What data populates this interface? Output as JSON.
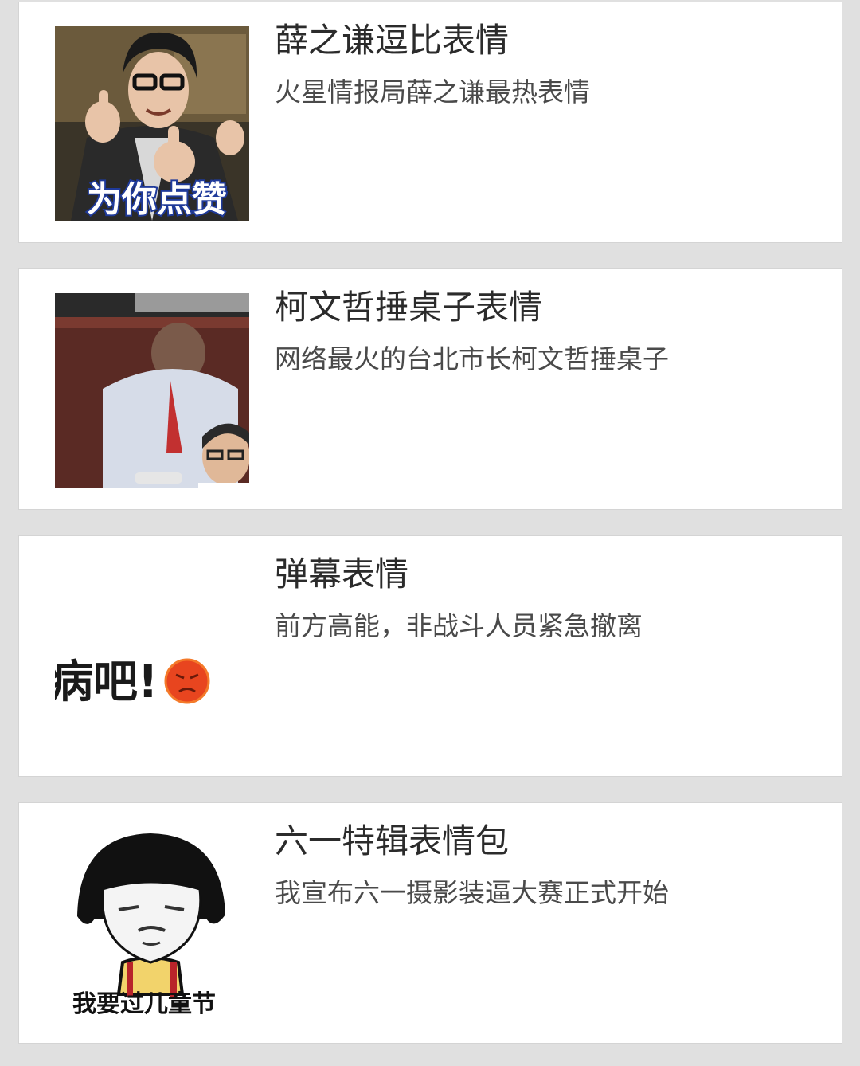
{
  "items": [
    {
      "title": "薛之谦逗比表情",
      "subtitle": "火星情报局薛之谦最热表情",
      "thumb_caption": "为你点赞"
    },
    {
      "title": "柯文哲捶桌子表情",
      "subtitle": "网络最火的台北市长柯文哲捶桌子"
    },
    {
      "title": "弹幕表情",
      "subtitle": "前方高能，非战斗人员紧急撤离",
      "thumb_caption": "病吧!"
    },
    {
      "title": "六一特辑表情包",
      "subtitle": "我宣布六一摄影装逼大赛正式开始",
      "thumb_caption": "我要过儿童节"
    }
  ],
  "colors": {
    "background": "#e0e0e0",
    "card": "#ffffff",
    "title": "#2b2b2b",
    "subtitle": "#4a4a4a"
  }
}
